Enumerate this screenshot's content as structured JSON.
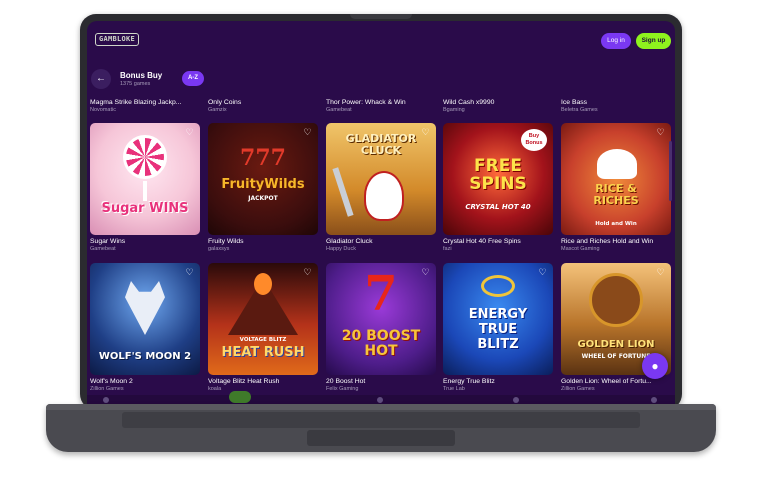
{
  "header": {
    "logo_text": "GAMBLOKE",
    "login_label": "Log in",
    "signup_label": "Sign up"
  },
  "section": {
    "title": "Bonus Buy",
    "count": "1375 games",
    "sort_label": "A-Z"
  },
  "previous_row": [
    {
      "name": "Magma Strike Blazing Jackp...",
      "provider": "Novomatic"
    },
    {
      "name": "Only Coins",
      "provider": "Gamzix"
    },
    {
      "name": "Thor Power: Whack & Win",
      "provider": "Gamebeat"
    },
    {
      "name": "Wild Cash x9990",
      "provider": "Bgaming"
    },
    {
      "name": "Ice Bass",
      "provider": "Beletra Games"
    }
  ],
  "games_row1": [
    {
      "name": "Sugar Wins",
      "provider": "Gamebeat",
      "art_text": "Sugar WINS",
      "bg": "#f6c6d8",
      "fg": "#e8317b"
    },
    {
      "name": "Fruity Wilds",
      "provider": "galaxsys",
      "art_text": "FruityWilds",
      "bg": "#3a0d0d",
      "fg": "#f7b72a"
    },
    {
      "name": "Gladiator Cluck",
      "provider": "Happy Duck",
      "art_text": "GLADIATOR CLUCK",
      "bg": "#d38a2a",
      "fg": "#fff1c0"
    },
    {
      "name": "Crystal Hot 40 Free Spins",
      "provider": "fazi",
      "art_text": "FREE SPINS",
      "bg": "#a3131b",
      "fg": "#fde34a"
    },
    {
      "name": "Rice and Riches Hold and Win",
      "provider": "Mascot Gaming",
      "art_text": "RICE & RICHES",
      "bg": "#c8402c",
      "fg": "#fbd34d"
    }
  ],
  "games_row2": [
    {
      "name": "Wolf's Moon 2",
      "provider": "Zillion Games",
      "art_text": "WOLF'S MOON 2",
      "bg": "#1f3f86",
      "fg": "#ffffff"
    },
    {
      "name": "Voltage Blitz Heat Rush",
      "provider": "koala",
      "art_text": "HEAT RUSH",
      "bg": "#b4321a",
      "fg": "#ffd86b"
    },
    {
      "name": "20 Boost Hot",
      "provider": "Felix Gaming",
      "art_text": "20 BOOST HOT",
      "bg": "#4e1d8a",
      "fg": "#f7c53a"
    },
    {
      "name": "Energy True Blitz",
      "provider": "True Lab",
      "art_text": "ENERGY TRUE BLITZ",
      "bg": "#1b48b8",
      "fg": "#ffffff"
    },
    {
      "name": "Golden Lion: Wheel of Fortu...",
      "provider": "Zillion Games",
      "art_text": "GOLDEN LION",
      "bg": "#b8742a",
      "fg": "#ffe27a"
    }
  ],
  "colors": {
    "screen_bg": "#2a0b4a",
    "accent": "#7a38f2",
    "signup": "#8ef21e"
  },
  "icons": {
    "back": "arrow-left-icon",
    "heart": "heart-icon",
    "fab": "support-icon"
  }
}
